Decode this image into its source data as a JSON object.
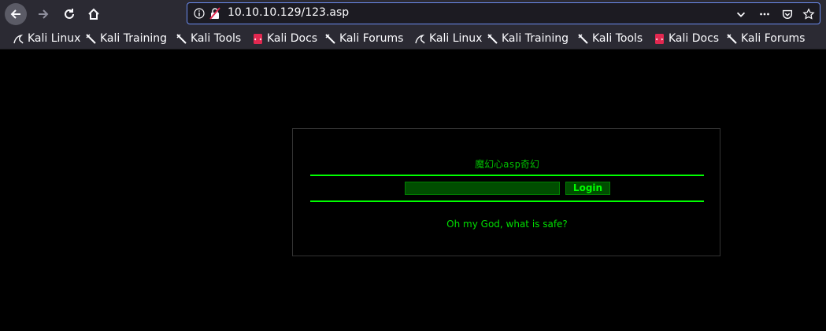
{
  "browser": {
    "url": "10.10.10.129/123.asp",
    "bookmarks": [
      {
        "label": "Kali Linux",
        "icon": "kali-dragon-icon"
      },
      {
        "label": "Kali Training",
        "icon": "kali-sword-icon"
      },
      {
        "label": "Kali Tools",
        "icon": "kali-sword-icon"
      },
      {
        "label": "Kali Docs",
        "icon": "kali-docs-icon"
      },
      {
        "label": "Kali Forums",
        "icon": "kali-sword-icon"
      },
      {
        "label": "Kali Linux",
        "icon": "kali-dragon-icon"
      },
      {
        "label": "Kali Training",
        "icon": "kali-sword-icon"
      },
      {
        "label": "Kali Tools",
        "icon": "kali-sword-icon"
      },
      {
        "label": "Kali Docs",
        "icon": "kali-docs-icon"
      },
      {
        "label": "Kali Forums",
        "icon": "kali-sword-icon"
      }
    ]
  },
  "page": {
    "title": "魔幻心asp奇幻",
    "login_label": "Login",
    "safe_text": "Oh my God, what is safe?"
  },
  "colors": {
    "background": "#000000",
    "accent": "#00ff00",
    "toolbar": "#2b2a33"
  }
}
